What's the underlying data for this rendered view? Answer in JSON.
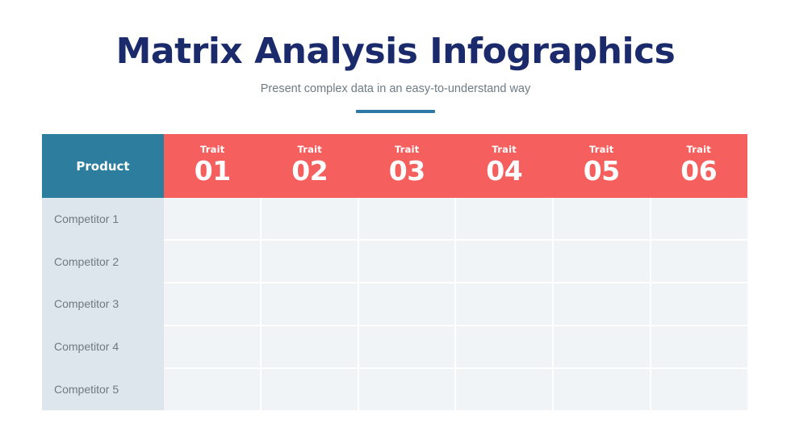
{
  "header": {
    "title": "Matrix Analysis Infographics",
    "subtitle": "Present complex data in an easy-to-understand way"
  },
  "colors": {
    "title": "#1b2a6b",
    "subtitle": "#6e7b85",
    "accent_bar": "#2c7aa5",
    "product_header": "#2d7d9f",
    "trait_header": "#f5605f",
    "row_label_bg": "#dde6ed",
    "cell_bg": "#f1f4f7",
    "background": "#ffffff"
  },
  "matrix": {
    "product_header": "Product",
    "trait_prefix": "Trait",
    "columns": [
      {
        "label": "Trait",
        "number": "01"
      },
      {
        "label": "Trait",
        "number": "02"
      },
      {
        "label": "Trait",
        "number": "03"
      },
      {
        "label": "Trait",
        "number": "04"
      },
      {
        "label": "Trait",
        "number": "05"
      },
      {
        "label": "Trait",
        "number": "06"
      }
    ],
    "rows": [
      {
        "label": "Competitor 1",
        "cells": [
          "",
          "",
          "",
          "",
          "",
          ""
        ]
      },
      {
        "label": "Competitor 2",
        "cells": [
          "",
          "",
          "",
          "",
          "",
          ""
        ]
      },
      {
        "label": "Competitor 3",
        "cells": [
          "",
          "",
          "",
          "",
          "",
          ""
        ]
      },
      {
        "label": "Competitor 4",
        "cells": [
          "",
          "",
          "",
          "",
          "",
          ""
        ]
      },
      {
        "label": "Competitor 5",
        "cells": [
          "",
          "",
          "",
          "",
          "",
          ""
        ]
      }
    ]
  }
}
